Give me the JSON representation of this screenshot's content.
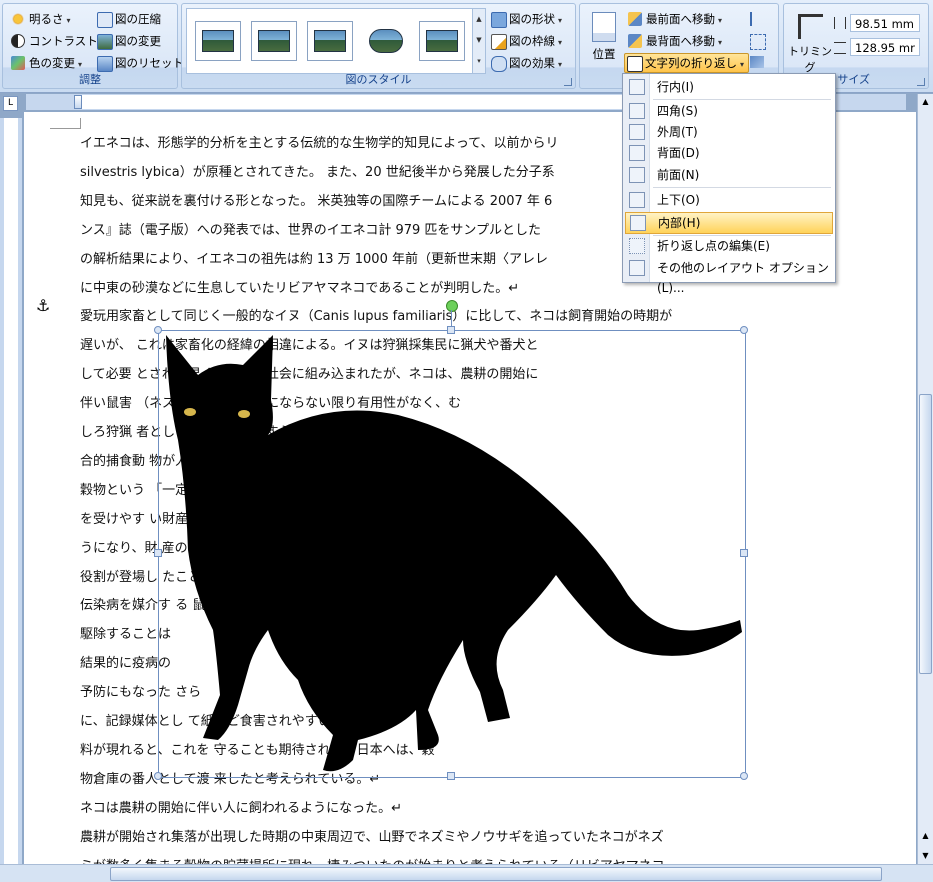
{
  "ribbon": {
    "adjust": {
      "label": "調整",
      "brightness": "明るさ",
      "contrast": "コントラスト",
      "recolor": "色の変更",
      "compress": "図の圧縮",
      "change": "図の変更",
      "reset": "図のリセット"
    },
    "styles": {
      "label": "図のスタイル",
      "shape": "図の形状",
      "border": "図の枠線",
      "effects": "図の効果"
    },
    "arrange": {
      "position": "位置",
      "bring_front": "最前面へ移動",
      "send_back": "最背面へ移動",
      "text_wrap": "文字列の折り返し"
    },
    "size": {
      "label": "サイズ",
      "crop": "トリミング",
      "height": "98.51 mm",
      "width": "128.95 mr"
    }
  },
  "wrap_menu": {
    "items": [
      "行内(I)",
      "四角(S)",
      "外周(T)",
      "背面(D)",
      "前面(N)",
      "上下(O)",
      "内部(H)",
      "折り返し点の編集(E)",
      "その他のレイアウト オプション(L)..."
    ],
    "highlighted_index": 6
  },
  "document": {
    "lines": [
      "イエネコは、形態学的分析を主とする伝統的な生物学的知見によって、以前からリ",
      "silvestris lybica）が原種とされてきた。 また、20 世紀後半から発展した分子系",
      "知見も、従来説を裏付ける形となった。 米英独等の国際チームによる 2007 年 6",
      "ンス』誌（電子版）への発表では、世界のイエネコ計 979 匹をサンプルとした",
      "の解析結果により、イエネコの祖先は約 13 万 1000 年前（更新世末期〈アレレ",
      "に中東の砂漠などに生息していたリビアヤマネコであることが判明した。↵",
      "愛玩用家畜として同じく一般的なイヌ（Canis lupus familiaris）に比して、ネコは飼育開始の時期が",
      "遅いが、                    これは家畜化の経緯の相違による。イヌは狩猟採集民に猟犬や番犬と",
      "して必要                    とされ、早くから人の社会に組み込まれたが、ネコは、農耕の開始に",
      "伴い鼠害                              （ネズミの害）が深刻にならない限り有用性がなく、む",
      "しろ狩猟                                              者としては競合相手ですらあった。その競",
      "合的捕食動                                          物が人のパートナーとなり得たのは、",
      "穀物という                                              「一定期間の保管を要する食害",
      "を受けやす                                              い財産」を人類が保有するよ",
      "うになり、財                                              産の番人としてのネコの",
      "役割が登場し                                              たことによる。また、",
      "伝染病を媒介す                                                          る 鼠 を",
      "駆除することは",
      "結果的に疫病の",
      "予防にもなった                                                              さら",
      "に、記録媒体とし                                          て紙など食害されやすい材",
      "料が現れると、これを                                      守ることも期待された。日本へは、穀",
      "物倉庫の番人として渡                                  来したと考えられている。↵",
      "ネコは農耕の開始に伴い人に飼われるようになった。↵",
      "農耕が開始され集落が出現した時期の中東周辺で、山野でネズミやノウサギを追っていたネコがネズ",
      "ミが数多く集まる穀物の貯蔵場所に現れ、棲みついたのが始まりと考えられている（リビアヤマネコ"
    ]
  },
  "colors": {
    "accent": "#15428b",
    "highlight": "#ffd35a",
    "ribbon": "#dbe7f7"
  }
}
